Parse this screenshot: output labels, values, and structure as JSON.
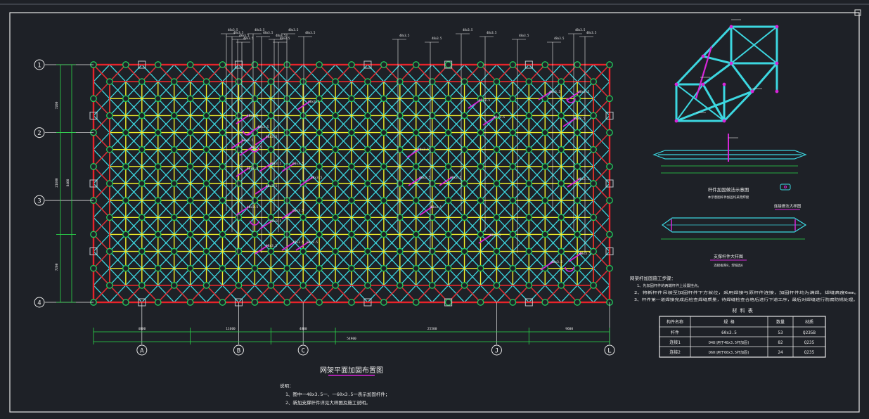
{
  "window": {
    "title": "网架平面加固布置图"
  },
  "colors": {
    "background": "#1e2127",
    "border": "#e6e6e6",
    "chord_red": "#e8232a",
    "grid_yellow": "#f2ef2a",
    "web_cyan": "#3cd7e0",
    "node_green": "#22c35a",
    "reinforce_magenta": "#d526d8",
    "annotation_white": "#e8e8e8",
    "dim_green": "#2bd84a"
  },
  "axes": {
    "rows": [
      "1",
      "2",
      "3",
      "4"
    ],
    "cols": [
      "A",
      "B",
      "C",
      "J",
      "L"
    ]
  },
  "dimensions": {
    "left": [
      "7200",
      "21600",
      "7200"
    ],
    "left_mid": "8400",
    "bottom": [
      "4800",
      "11600",
      "4800",
      "25500",
      "9600"
    ],
    "total": "54900"
  },
  "labels": {
    "member_tag_a": "48x3.5",
    "member_tag_b": "60x3.5",
    "plan_title": "网架平面加固布置图",
    "detail_title_1": "杆件加固做法示意图",
    "detail_note_1": "本示意图杆件加固均采用焊接",
    "detail_title_2": "连接做法大样图",
    "detail_title_3": "支撑杆件大样图",
    "detail_note_3": "连接板厚8，焊缝高6"
  },
  "construction_notes": {
    "heading": "网架杆加固施工步骤：",
    "items": [
      "1、先加固杆件的两端杆件上设置挂点。",
      "2、将新杆件吊装至加固杆件下方就位，采用焊接与原杆件连接，加固杆件均为满焊，焊缝高度6mm。",
      "3、杆件第一道焊接完成后检查焊缝质量，待焊缝检查合格后进行下道工序，最后对焊缝进行防腐防锈处理。"
    ]
  },
  "material_table": {
    "title": "材 料 表",
    "headers": [
      "构件名称",
      "规 格",
      "数量",
      "材质"
    ],
    "rows": [
      [
        "杆件",
        "60x3.5",
        "53",
        "Q235B"
      ],
      [
        "连接1",
        "D48(用于48x3.5杆加固)",
        "82",
        "Q235"
      ],
      [
        "连接2",
        "D60(用于60x3.5杆加固)",
        "24",
        "Q235"
      ]
    ]
  },
  "notes": {
    "heading": "说明：",
    "items": [
      "1、图中一48x3.5一、一60x3.5一表示加固杆件；",
      "2、新加支撑杆件详见大样图及施工说明。"
    ]
  }
}
